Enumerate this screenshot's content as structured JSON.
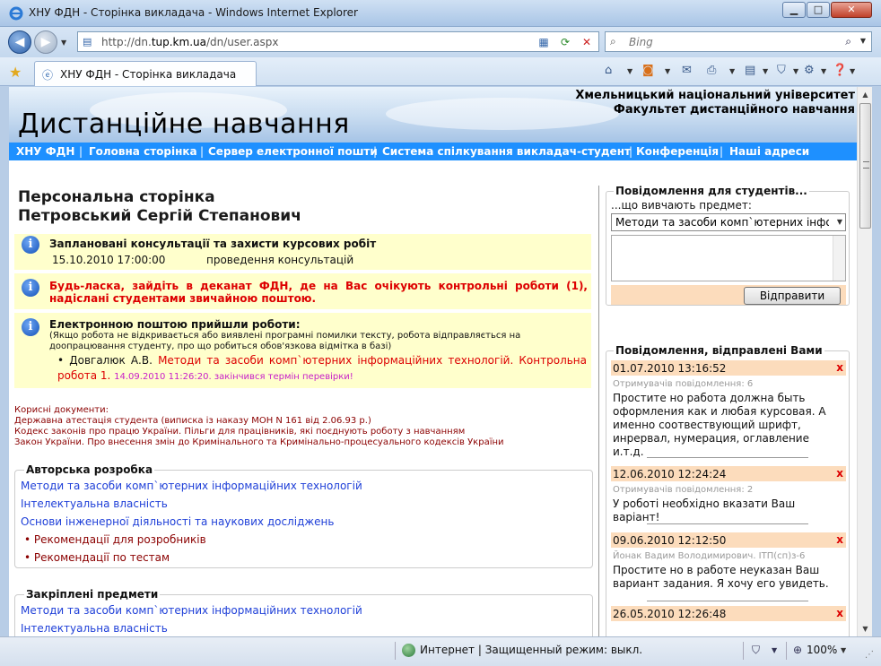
{
  "window": {
    "title": "ХНУ ФДН - Сторінка викладача - Windows Internet Explorer",
    "min_glyph": "▁",
    "max_glyph": "□",
    "close_glyph": "✕"
  },
  "addressbar": {
    "url_prefix": "http://dn.",
    "url_domain": "tup.km.ua",
    "url_suffix": "/dn/user.aspx",
    "search_placeholder": "Bing"
  },
  "tab": {
    "label": "ХНУ ФДН - Сторінка викладача"
  },
  "site": {
    "university": "Хмельницький національний університет",
    "faculty": "Факультет дистанційного навчання",
    "name": "Дистанційне навчання",
    "menu": [
      "ХНУ ФДН",
      "Головна сторінка",
      "Сервер електронної пошти",
      "Система спілкування викладач-студент",
      "Конференція",
      "Наші адреси"
    ]
  },
  "page": {
    "title_line1": "Персональна сторінка",
    "title_line2": "Петровський Сергій Степанович"
  },
  "consult": {
    "heading": "Заплановані консультації та захисти курсових робіт",
    "date": "15.10.2010 17:00:00",
    "text": "проведення консультацій"
  },
  "alert": {
    "message": "Будь-ласка, зайдіть в деканат ФДН, де на Вас очікують контрольні роботи (1), надіслані студентами звичайною поштою."
  },
  "works": {
    "heading": "Електронною поштою прийшли роботи:",
    "note": "(Якщо робота не відкривається або виявлені програмні помилки тексту, робота відправляється на доопрацювання студенту, про що робиться обов'язкова відмітка в базі)",
    "student": "Довгалюк А.В.",
    "work": "Методи та засоби комп`ютерних інформаційних технологій. Контрольна робота 1.",
    "deadline": "14.09.2010 11:26:20. закінчився термін перевірки!"
  },
  "useful_docs": {
    "heading": "Корисні документи:",
    "items": [
      "Державна атестація студента (виписка із наказу МОН N 161 від 2.06.93 р.)",
      "Кодекс законів про працю України. Пільги для працівників, які поєднують роботу з навчанням",
      "Закон України. Про внесення змін до Кримінального та Кримінально-процесуального кодексів України"
    ]
  },
  "authored": {
    "legend": "Авторська розробка",
    "links": [
      "Методи та засоби комп`ютерних інформаційних технологій",
      "Інтелектуальна власність",
      "Основи інженерної діяльності та наукових досліджень"
    ],
    "extra": [
      "Рекомендації для розробників",
      "Рекомендації по тестам"
    ]
  },
  "assigned": {
    "legend": "Закріплені предмети",
    "links": [
      "Методи та засоби комп`ютерних інформаційних технологій",
      "Інтелектуальна власність"
    ]
  },
  "notify": {
    "legend": "Повідомлення для студентів...",
    "sub": "...що вивчають предмет:",
    "selected": "Методи та засоби комп`ютерних інформаційних технологій",
    "send": "Відправити"
  },
  "sent": {
    "legend": "Повідомлення, відправлені Вами",
    "delete_glyph": "x",
    "messages": [
      {
        "date": "01.07.2010 13:16:52",
        "recipients": "Отримувачів повідомлення: 6",
        "text": "Простите но работа должна быть оформления как и любая курсовая. А именно соотвествующий шрифт, инрервал, нумерация, оглавление и.т.д."
      },
      {
        "date": "12.06.2010 12:24:24",
        "recipients": "Отримувачів повідомлення: 2",
        "text": "У роботі необхідно вказати Ваш варіант!"
      },
      {
        "date": "09.06.2010 12:12:50",
        "recipients": "Йонак Вадим Володимирович. ІТП(сп)з-6",
        "text": "Простите но в работе неуказан Ваш вариант задания. Я хочу его увидеть."
      },
      {
        "date": "26.05.2010 12:26:48",
        "recipients": "",
        "text": ""
      }
    ]
  },
  "status": {
    "zone": "Интернет | Защищенный режим: выкл.",
    "zoom": "100%"
  },
  "icons": {
    "back": "back-arrow-icon",
    "forward": "forward-arrow-icon",
    "refresh": "refresh-icon",
    "stop": "stop-icon",
    "search": "search-icon",
    "favorites": "star-icon",
    "home": "home-icon",
    "rss": "rss-icon",
    "mail": "mail-icon",
    "print": "printer-icon",
    "page": "page-icon",
    "safety": "shield-icon",
    "tools": "gear-icon",
    "help": "help-icon",
    "info": "info-icon"
  },
  "colors": {
    "menu_bar": "#1e90ff",
    "info_bg": "#ffffcc",
    "alert_text": "#dd0000",
    "link": "#1e3fd8",
    "msg_header": "#fcdcbc"
  }
}
